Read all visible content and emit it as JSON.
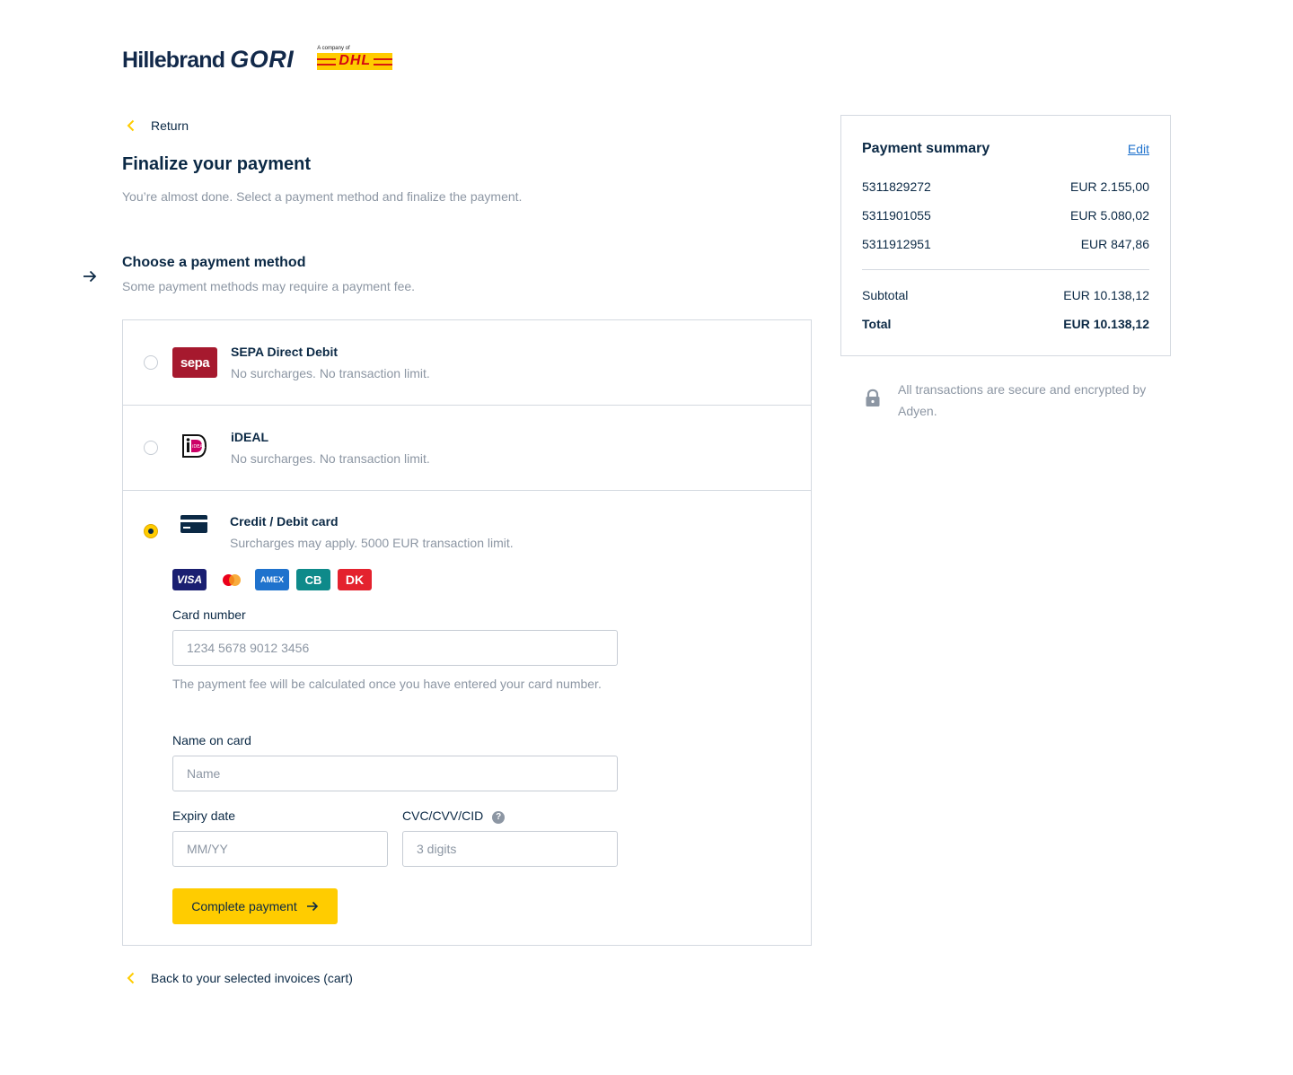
{
  "brand": {
    "name": "Hillebrand",
    "name_accent": "GORI",
    "dhl_caption": "A company of",
    "dhl_text": "DHL"
  },
  "nav": {
    "return_label": "Return",
    "back_label": "Back to your selected invoices (cart)"
  },
  "page": {
    "title": "Finalize your payment",
    "subtitle": "You’re almost done. Select a payment method and finalize the payment."
  },
  "methods_section": {
    "title": "Choose a payment method",
    "subtitle": "Some payment methods may require a payment fee.",
    "methods": [
      {
        "name": "SEPA Direct Debit",
        "description": "No surcharges. No transaction limit.",
        "logo_text": "sepa",
        "selected": false
      },
      {
        "name": "iDEAL",
        "description": "No surcharges. No transaction limit.",
        "logo_text": "iDEAL",
        "selected": false
      },
      {
        "name": "Credit / Debit card",
        "description": "Surcharges may apply. 5000 EUR transaction limit.",
        "selected": true
      }
    ],
    "card_brands": [
      "VISA",
      "",
      "AMEX",
      "CB",
      "DK"
    ]
  },
  "card_form": {
    "card_number": {
      "label": "Card number",
      "placeholder": "1234 5678 9012 3456",
      "value": ""
    },
    "fee_hint": "The payment fee will be calculated once you have entered your card number.",
    "name": {
      "label": "Name on card",
      "placeholder": "Name",
      "value": ""
    },
    "expiry": {
      "label": "Expiry date",
      "placeholder": "MM/YY",
      "value": ""
    },
    "cvc": {
      "label": "CVC/CVV/CID",
      "placeholder": "3 digits",
      "value": "",
      "help": "?"
    },
    "submit_label": "Complete payment"
  },
  "summary": {
    "title": "Payment summary",
    "edit_label": "Edit",
    "invoices": [
      {
        "id": "5311829272",
        "amount": "EUR 2.155,00"
      },
      {
        "id": "5311901055",
        "amount": "EUR 5.080,02"
      },
      {
        "id": "5311912951",
        "amount": "EUR 847,86"
      }
    ],
    "subtotal_label": "Subtotal",
    "subtotal": "EUR 10.138,12",
    "total_label": "Total",
    "total": "EUR 10.138,12"
  },
  "security_note": "All transactions are secure and encrypted by Adyen.",
  "colors": {
    "accent": "#ffcc00",
    "text": "#0b2945",
    "muted": "#8c96a3",
    "border": "#d4d9e0",
    "link": "#1f72cd"
  }
}
